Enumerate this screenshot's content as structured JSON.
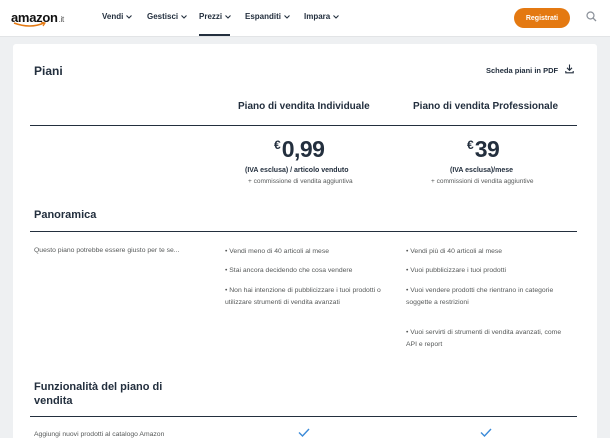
{
  "header": {
    "logo_text": "amazon",
    "logo_tld": ".it",
    "nav": [
      {
        "label": "Vendi"
      },
      {
        "label": "Gestisci"
      },
      {
        "label": "Prezzi"
      },
      {
        "label": "Espanditi"
      },
      {
        "label": "Impara"
      }
    ],
    "active_nav": "Prezzi",
    "register_label": "Registrati",
    "accent_color": "#e47911"
  },
  "plans": {
    "title": "Piani",
    "pdf_link": "Scheda piani in PDF",
    "columns": [
      {
        "name": "Piano di vendita Individuale",
        "currency": "€",
        "price": "0,99",
        "vat_note": "(IVA esclusa) / articolo venduto",
        "commission_note": "+ commissione di vendita aggiuntiva"
      },
      {
        "name": "Piano di vendita Professionale",
        "currency": "€",
        "price": "39",
        "vat_note": "(IVA esclusa)/mese",
        "commission_note": "+ commissioni di vendita aggiuntive"
      }
    ]
  },
  "overview": {
    "title": "Panoramica",
    "description": "Questo piano potrebbe essere giusto per te se...",
    "individual_bullets": [
      "• Vendi meno di 40 articoli al mese",
      "• Stai ancora decidendo che cosa vendere",
      "• Non hai intenzione di pubblicizzare i tuoi prodotti o utilizzare strumenti di vendita avanzati"
    ],
    "professional_bullets": [
      "• Vendi più di 40 articoli al mese",
      "• Vuoi pubblicizzare i tuoi prodotti",
      "• Vuoi vendere prodotti che rientrano in categorie soggette a restrizioni",
      "• Vuoi servirti di strumenti di vendita avanzati, come API e report"
    ]
  },
  "features": {
    "title": "Funzionalità del piano di vendita",
    "rows": [
      {
        "label": "Aggiungi nuovi prodotti al catalogo Amazon"
      }
    ]
  }
}
